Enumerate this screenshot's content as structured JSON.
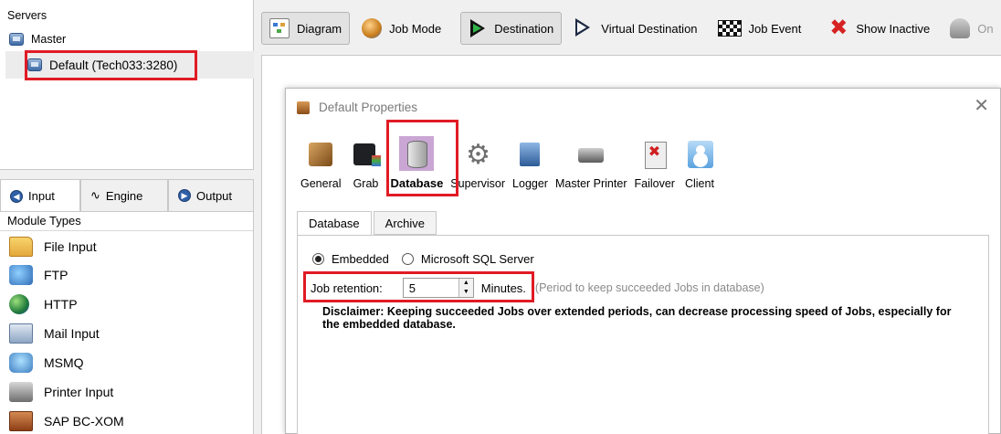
{
  "servers": {
    "header": "Servers",
    "master": "Master",
    "default": "Default (Tech033:3280)"
  },
  "left_tabs": [
    {
      "label": "Input",
      "active": true
    },
    {
      "label": "Engine",
      "active": false
    },
    {
      "label": "Output",
      "active": false
    }
  ],
  "modules": {
    "header": "Module Types",
    "items": [
      {
        "label": "File Input",
        "icon": "folder-icon"
      },
      {
        "label": "FTP",
        "icon": "ftp-icon"
      },
      {
        "label": "HTTP",
        "icon": "globe-icon"
      },
      {
        "label": "Mail Input",
        "icon": "mail-icon"
      },
      {
        "label": "MSMQ",
        "icon": "msmq-icon"
      },
      {
        "label": "Printer Input",
        "icon": "printer-icon"
      },
      {
        "label": "SAP BC-XOM",
        "icon": "sap-icon"
      }
    ]
  },
  "toolbar": {
    "diagram": "Diagram",
    "job_mode": "Job Mode",
    "destination": "Destination",
    "virtual_destination": "Virtual Destination",
    "job_event": "Job Event",
    "show_inactive": "Show Inactive",
    "on": "On"
  },
  "dialog": {
    "title": "Default Properties",
    "close": "✕",
    "categories": [
      {
        "label": "General",
        "icon": "general-icon"
      },
      {
        "label": "Grab",
        "icon": "grab-icon"
      },
      {
        "label": "Database",
        "icon": "database-icon",
        "selected": true
      },
      {
        "label": "Supervisor",
        "icon": "supervisor-icon"
      },
      {
        "label": "Logger",
        "icon": "logger-icon"
      },
      {
        "label": "Master Printer",
        "icon": "printer-icon"
      },
      {
        "label": "Failover",
        "icon": "failover-icon"
      },
      {
        "label": "Client",
        "icon": "client-icon"
      }
    ],
    "tabs": [
      {
        "label": "Database",
        "active": true
      },
      {
        "label": "Archive",
        "active": false
      }
    ],
    "radio_embedded": "Embedded",
    "radio_mssql": "Microsoft SQL Server",
    "embedded_selected": true,
    "retention_label": "Job retention:",
    "retention_value": "5",
    "retention_unit": "Minutes.",
    "retention_hint": "(Period to keep succeeded Jobs in database)",
    "disclaimer": "Disclaimer: Keeping succeeded Jobs over extended periods, can decrease processing speed of Jobs, especially for the embedded database."
  },
  "colors": {
    "highlight_box": "#e01b24",
    "selected_category": "#c9a6d3"
  }
}
